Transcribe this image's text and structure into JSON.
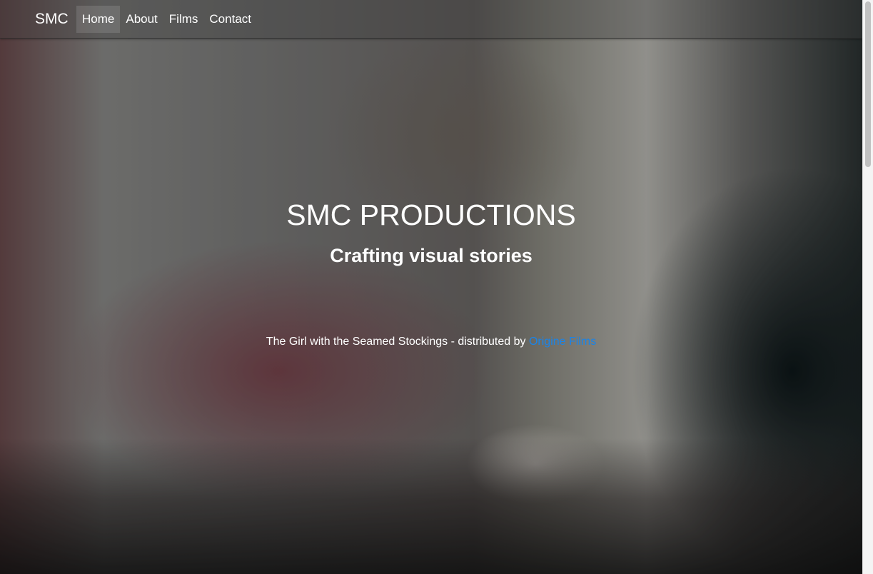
{
  "navbar": {
    "brand": "SMC",
    "items": [
      {
        "label": "Home",
        "active": true
      },
      {
        "label": "About",
        "active": false
      },
      {
        "label": "Films",
        "active": false
      },
      {
        "label": "Contact",
        "active": false
      }
    ]
  },
  "hero": {
    "title": "SMC PRODUCTIONS",
    "subtitle": "Crafting visual stories",
    "credit_text": "The Girl with the Seamed Stockings - distributed by ",
    "credit_link": "Origine Films"
  },
  "colors": {
    "link": "#1a84e8",
    "text": "#ffffff"
  }
}
